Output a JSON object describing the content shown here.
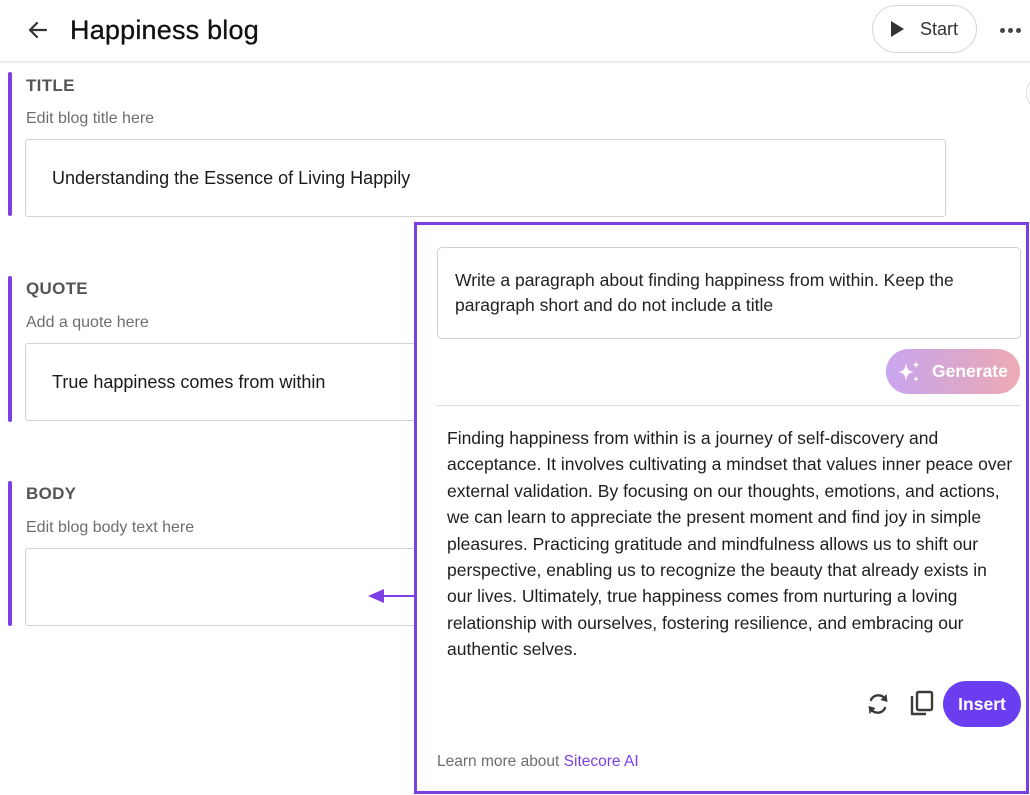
{
  "header": {
    "title": "Happiness blog",
    "start_label": "Start",
    "back_icon": "arrow-left-icon",
    "more_icon": "ellipsis-icon"
  },
  "fields": {
    "title": {
      "label": "TITLE",
      "hint": "Edit blog title here",
      "value": "Understanding the Essence of Living Happily"
    },
    "quote": {
      "label": "QUOTE",
      "hint": "Add a quote here",
      "value": "True happiness comes from within"
    },
    "body": {
      "label": "BODY",
      "hint": "Edit blog body text here",
      "value": ""
    }
  },
  "ai_panel": {
    "prompt": "Write a paragraph about finding happiness from within. Keep the paragraph short and do not include a title",
    "generate_label": "Generate",
    "result": "Finding happiness from within is a journey of self-discovery and acceptance. It involves cultivating a mindset that values inner peace over external validation. By focusing on our thoughts, emotions, and actions, we can learn to appreciate the present moment and find joy in simple pleasures. Practicing gratitude and mindfulness allows us to shift our perspective, enabling us to recognize the beauty that already exists in our lives. Ultimately, true happiness comes from nurturing a loving relationship with ourselves, fostering resilience, and embracing our authentic selves.",
    "insert_label": "Insert",
    "learn_more_prefix": "Learn more about ",
    "learn_more_link": "Sitecore AI"
  },
  "colors": {
    "accent": "#7b3fe4",
    "insert_button": "#6a3df0",
    "generate_gradient_start": "#c9a6f0",
    "generate_gradient_end": "#eeaab4"
  }
}
